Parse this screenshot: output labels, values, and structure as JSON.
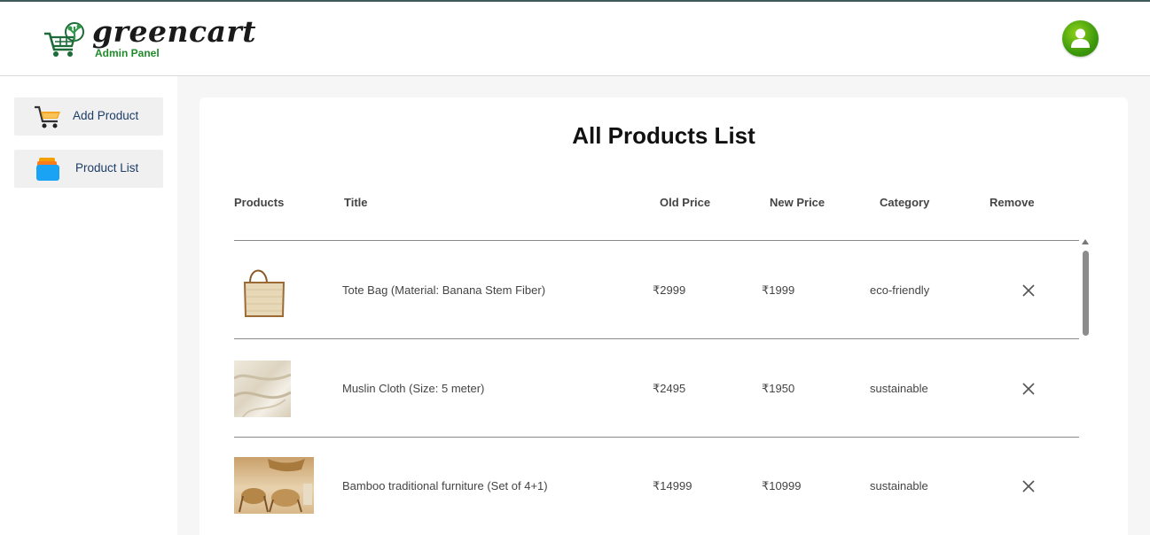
{
  "header": {
    "brand": "greencart",
    "subtitle": "Admin Panel",
    "logo_icon": "shopping-cart-tree-icon",
    "avatar_icon": "user-icon"
  },
  "sidebar": {
    "items": [
      {
        "label": "Add Product",
        "icon": "shopping-cart-icon"
      },
      {
        "label": "Product List",
        "icon": "stacked-list-icon"
      }
    ]
  },
  "main": {
    "title": "All Products List",
    "columns": [
      "Products",
      "Title",
      "Old Price",
      "New Price",
      "Category",
      "Remove"
    ],
    "rows": [
      {
        "image": "tote-bag-image",
        "title": "Tote Bag (Material: Banana Stem Fiber)",
        "old_price": "₹2999",
        "new_price": "₹1999",
        "category": "eco-friendly",
        "remove_icon": "close-icon"
      },
      {
        "image": "muslin-cloth-image",
        "title": "Muslin Cloth (Size: 5 meter)",
        "old_price": "₹2495",
        "new_price": "₹1950",
        "category": "sustainable",
        "remove_icon": "close-icon"
      },
      {
        "image": "bamboo-furniture-image",
        "title": "Bamboo traditional furniture (Set of 4+1)",
        "old_price": "₹14999",
        "new_price": "₹10999",
        "category": "sustainable",
        "remove_icon": "close-icon"
      }
    ]
  },
  "colors": {
    "brand_green": "#1f8a2a",
    "sidebar_text": "#1c3d66",
    "avatar_green": "#3d9a0c"
  }
}
